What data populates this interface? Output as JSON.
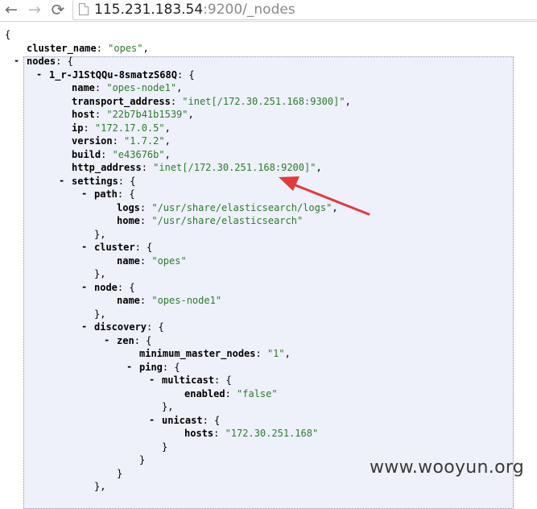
{
  "browser": {
    "back_icon": "←",
    "forward_icon": "→",
    "reload_icon": "⟳",
    "url_host": "115.231.183.54",
    "url_rest": ":9200/_nodes"
  },
  "json_view": {
    "root_open": "{",
    "cluster_name_key": "cluster_name",
    "cluster_name_value": "\"opes\"",
    "nodes_key": "nodes",
    "node_id_key": "1_r-J1StQQu-8smatzS68Q",
    "fields": [
      {
        "key": "name",
        "value": "\"opes-node1\""
      },
      {
        "key": "transport_address",
        "value": "\"inet[/172.30.251.168:9300]\""
      },
      {
        "key": "host",
        "value": "\"22b7b41b1539\""
      },
      {
        "key": "ip",
        "value": "\"172.17.0.5\""
      },
      {
        "key": "version",
        "value": "\"1.7.2\""
      },
      {
        "key": "build",
        "value": "\"e43676b\""
      },
      {
        "key": "http_address",
        "value": "\"inet[/172.30.251.168:9200]\""
      }
    ],
    "settings_key": "settings",
    "path_key": "path",
    "logs_key": "logs",
    "logs_value": "\"/usr/share/elasticsearch/logs\"",
    "home_key": "home",
    "home_value": "\"/usr/share/elasticsearch\"",
    "cluster_key": "cluster",
    "cluster_name_inner_key": "name",
    "cluster_name_inner_value": "\"opes\"",
    "node_key": "node",
    "node_name_key": "name",
    "node_name_value": "\"opes-node1\"",
    "discovery_key": "discovery",
    "zen_key": "zen",
    "min_master_key": "minimum_master_nodes",
    "min_master_value": "\"1\"",
    "ping_key": "ping",
    "multicast_key": "multicast",
    "enabled_key": "enabled",
    "enabled_value": "\"false\"",
    "unicast_key": "unicast",
    "hosts_key": "hosts",
    "hosts_value": "\"172.30.251.168\"",
    "toggle_symbol": "-"
  },
  "colors": {
    "string": "#2b7d2b",
    "arrow": "#e23b3b",
    "box_bg": "#eef0fa"
  },
  "watermark": "www.wooyun.org"
}
